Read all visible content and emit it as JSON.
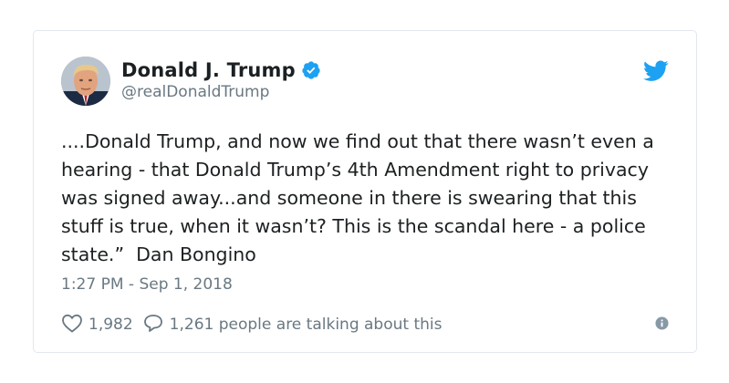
{
  "tweet": {
    "author": {
      "display_name": "Donald J. Trump",
      "handle": "@realDonaldTrump",
      "verified": true
    },
    "text": "....Donald Trump, and now we find out that there wasn’t even a hearing - that Donald Trump’s 4th Amendment right to privacy was signed away...and someone in there is swearing that this stuff is true, when it wasn’t? This is the scandal here - a police state.”  Dan Bongino",
    "timestamp": "1:27 PM - Sep 1, 2018",
    "likes": "1,982",
    "talking": "1,261 people are talking about this"
  },
  "icons": {
    "avatar": "avatar",
    "verified": "verified-badge-icon",
    "platform": "twitter-bird-icon",
    "like": "heart-icon",
    "reply": "reply-bubble-icon",
    "info": "info-icon"
  },
  "colors": {
    "accent": "#1da1f2",
    "text": "#1c2022",
    "secondary": "#697882",
    "border": "#e1e8ed"
  }
}
